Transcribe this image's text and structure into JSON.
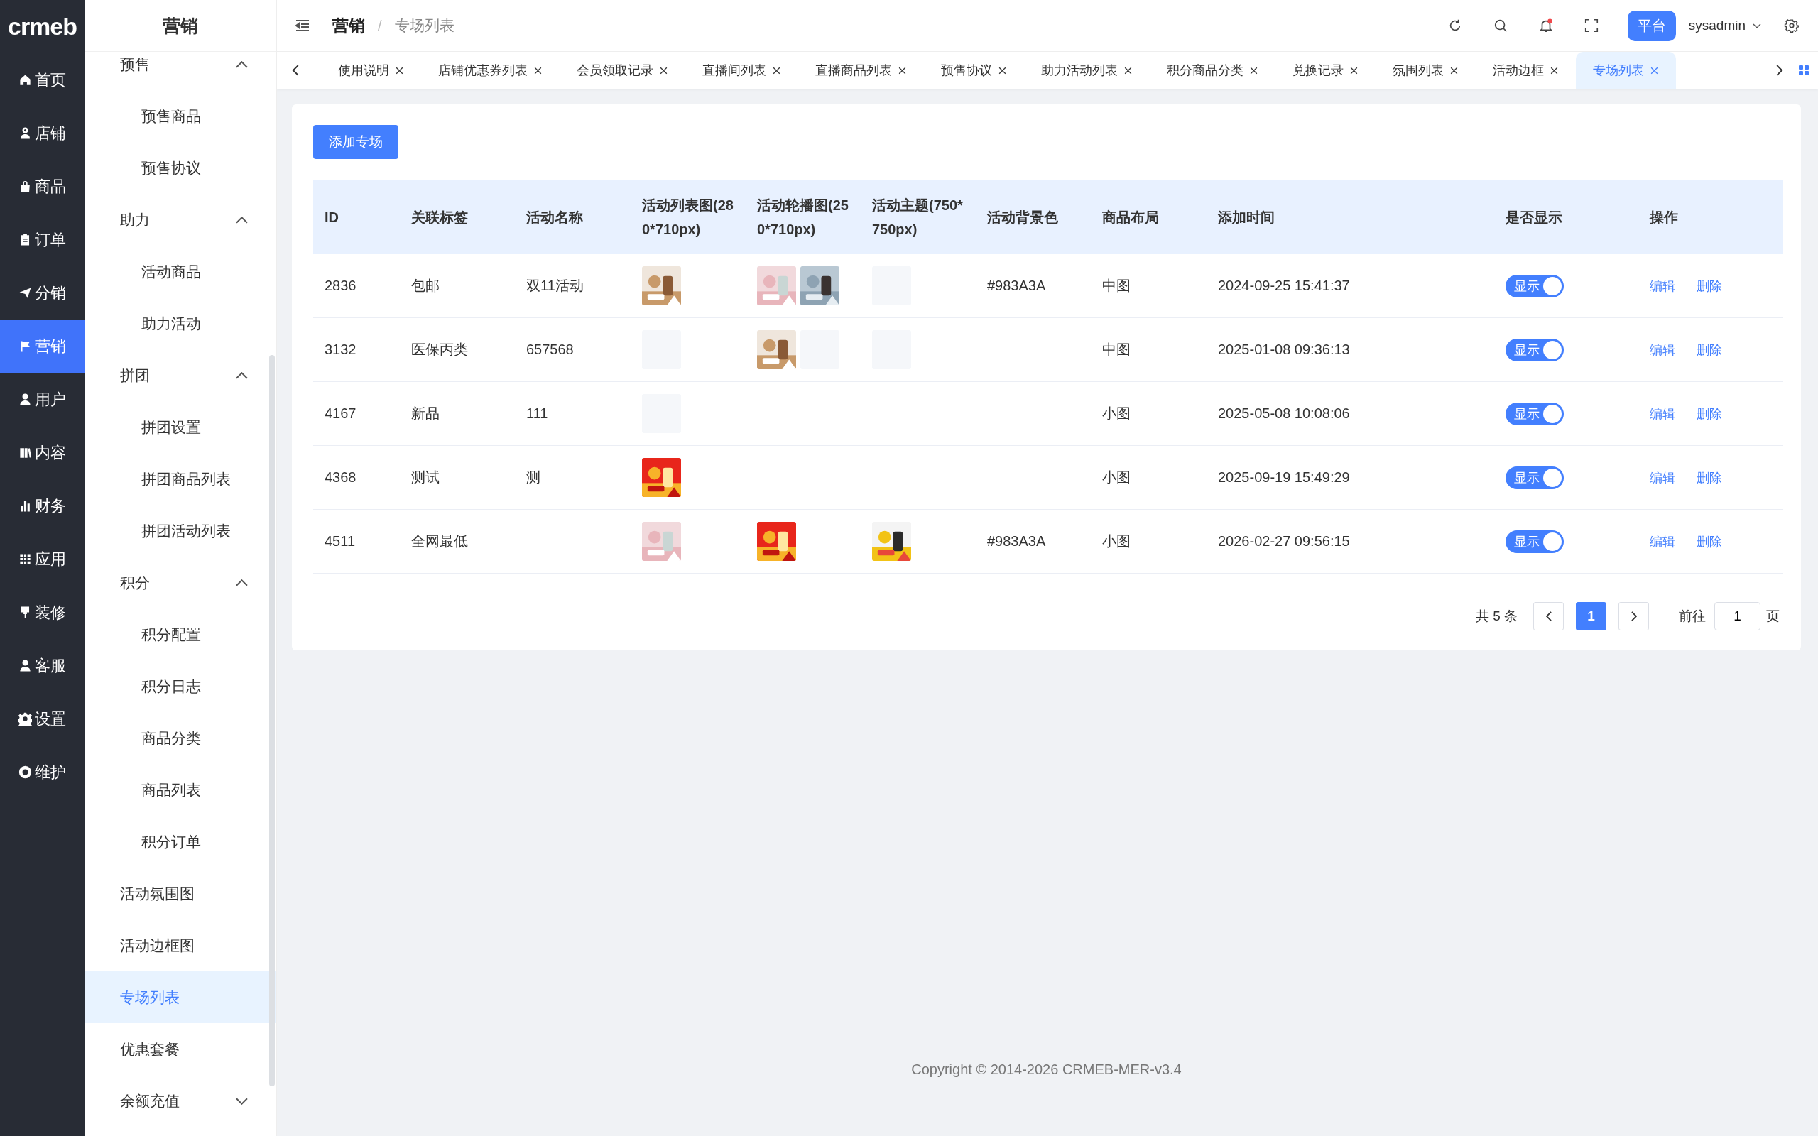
{
  "logo": "crmeb",
  "nav": [
    {
      "label": "首页",
      "selected": false
    },
    {
      "label": "店铺",
      "selected": false
    },
    {
      "label": "商品",
      "selected": false
    },
    {
      "label": "订单",
      "selected": false
    },
    {
      "label": "分销",
      "selected": false
    },
    {
      "label": "营销",
      "selected": true
    },
    {
      "label": "用户",
      "selected": false
    },
    {
      "label": "内容",
      "selected": false
    },
    {
      "label": "财务",
      "selected": false
    },
    {
      "label": "应用",
      "selected": false
    },
    {
      "label": "装修",
      "selected": false
    },
    {
      "label": "客服",
      "selected": false
    },
    {
      "label": "设置",
      "selected": false
    },
    {
      "label": "维护",
      "selected": false
    }
  ],
  "submenu": {
    "title": "营销",
    "items": [
      {
        "kind": "group",
        "label": "预售",
        "expanded": true,
        "children": [
          {
            "label": "预售商品",
            "selected": false
          },
          {
            "label": "预售协议",
            "selected": false
          }
        ]
      },
      {
        "kind": "group",
        "label": "助力",
        "expanded": true,
        "children": [
          {
            "label": "活动商品",
            "selected": false
          },
          {
            "label": "助力活动",
            "selected": false
          }
        ]
      },
      {
        "kind": "group",
        "label": "拼团",
        "expanded": true,
        "children": [
          {
            "label": "拼团设置",
            "selected": false
          },
          {
            "label": "拼团商品列表",
            "selected": false
          },
          {
            "label": "拼团活动列表",
            "selected": false
          }
        ]
      },
      {
        "kind": "group",
        "label": "积分",
        "expanded": true,
        "children": [
          {
            "label": "积分配置",
            "selected": false
          },
          {
            "label": "积分日志",
            "selected": false
          },
          {
            "label": "商品分类",
            "selected": false
          },
          {
            "label": "商品列表",
            "selected": false
          },
          {
            "label": "积分订单",
            "selected": false
          }
        ]
      },
      {
        "kind": "item",
        "label": "活动氛围图",
        "selected": false
      },
      {
        "kind": "item",
        "label": "活动边框图",
        "selected": false
      },
      {
        "kind": "item",
        "label": "专场列表",
        "selected": true
      },
      {
        "kind": "item",
        "label": "优惠套餐",
        "selected": false
      },
      {
        "kind": "group",
        "label": "余额充值",
        "expanded": false
      }
    ]
  },
  "breadcrumb": {
    "parent": "营销",
    "separator": "/",
    "current": "专场列表"
  },
  "header": {
    "platform": "平台",
    "user": "sysadmin"
  },
  "tabs": [
    {
      "label": "使用说明",
      "selected": false
    },
    {
      "label": "店铺优惠券列表",
      "selected": false
    },
    {
      "label": "会员领取记录",
      "selected": false
    },
    {
      "label": "直播间列表",
      "selected": false
    },
    {
      "label": "直播商品列表",
      "selected": false
    },
    {
      "label": "预售协议",
      "selected": false
    },
    {
      "label": "助力活动列表",
      "selected": false
    },
    {
      "label": "积分商品分类",
      "selected": false
    },
    {
      "label": "兑换记录",
      "selected": false
    },
    {
      "label": "氛围列表",
      "selected": false
    },
    {
      "label": "活动边框",
      "selected": false
    },
    {
      "label": "专场列表",
      "selected": true
    }
  ],
  "add_button": "添加专场",
  "table": {
    "columns": [
      "ID",
      "关联标签",
      "活动名称",
      "活动列表图(280*710px)",
      "活动轮播图(250*710px)",
      "活动主题(750*750px)",
      "活动背景色",
      "商品布局",
      "添加时间",
      "是否显示",
      "操作"
    ],
    "rows": [
      {
        "id": "2836",
        "tag": "包邮",
        "name": "双11活动",
        "list_images": [
          {
            "kind": "picture"
          }
        ],
        "carousel_images": [
          {
            "kind": "picture"
          },
          {
            "kind": "picture"
          }
        ],
        "theme_images": [
          {
            "kind": "blank"
          }
        ],
        "bg_color": "#983A3A",
        "layout": "中图",
        "added_time": "2024-09-25 15:41:37",
        "display": {
          "label": "显示",
          "on": true
        },
        "actions": [
          "编辑",
          "删除"
        ]
      },
      {
        "id": "3132",
        "tag": "医保丙类",
        "name": "657568",
        "list_images": [
          {
            "kind": "blank"
          }
        ],
        "carousel_images": [
          {
            "kind": "picture"
          },
          {
            "kind": "blank"
          }
        ],
        "theme_images": [
          {
            "kind": "blank"
          }
        ],
        "layout": "中图",
        "added_time": "2025-01-08 09:36:13",
        "display": {
          "label": "显示",
          "on": true
        },
        "actions": [
          "编辑",
          "删除"
        ]
      },
      {
        "id": "4167",
        "tag": "新品",
        "name": "111",
        "list_images": [
          {
            "kind": "blank"
          }
        ],
        "layout": "小图",
        "added_time": "2025-05-08 10:08:06",
        "display": {
          "label": "显示",
          "on": true
        },
        "actions": [
          "编辑",
          "删除"
        ]
      },
      {
        "id": "4368",
        "tag": "测试",
        "name": "测",
        "list_images": [
          {
            "kind": "picture"
          }
        ],
        "layout": "小图",
        "added_time": "2025-09-19 15:49:29",
        "display": {
          "label": "显示",
          "on": true
        },
        "actions": [
          "编辑",
          "删除"
        ]
      },
      {
        "id": "4511",
        "tag": "全网最低",
        "list_images": [
          {
            "kind": "picture"
          }
        ],
        "carousel_images": [
          {
            "kind": "picture"
          }
        ],
        "theme_images": [
          {
            "kind": "picture"
          }
        ],
        "bg_color": "#983A3A",
        "layout": "小图",
        "added_time": "2026-02-27 09:56:15",
        "display": {
          "label": "显示",
          "on": true
        },
        "actions": [
          "编辑",
          "删除"
        ]
      }
    ]
  },
  "pagination": {
    "total": "共 5 条",
    "pages": [
      {
        "label": "1",
        "selected": true
      }
    ],
    "goto_label": "前往",
    "goto_value": "1",
    "page_unit": "页"
  },
  "footer": "Copyright © 2014-2026 CRMEB-MER-v3.4"
}
